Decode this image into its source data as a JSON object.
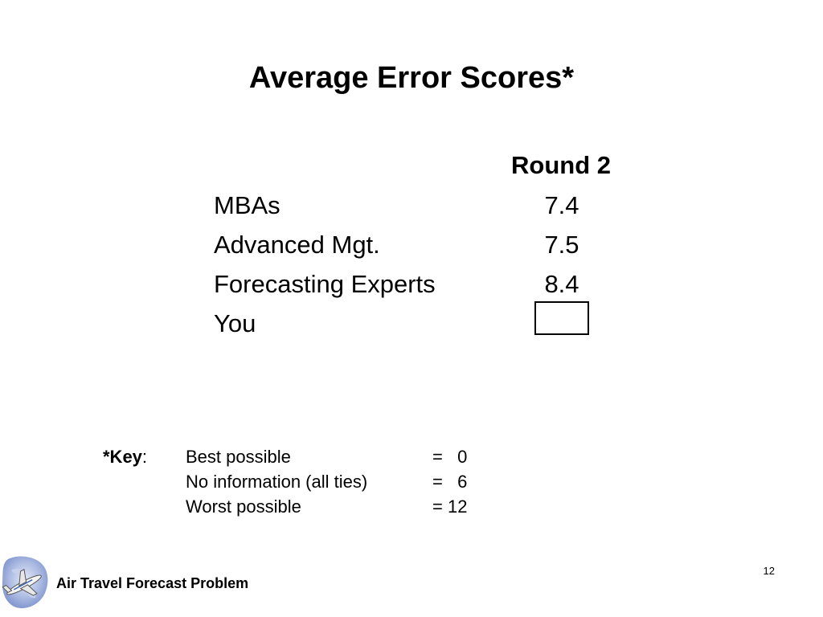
{
  "slide": {
    "title": "Average Error Scores*",
    "column_header": "Round 2",
    "rows": [
      {
        "label": "MBAs",
        "value": "7.4"
      },
      {
        "label": "Advanced Mgt.",
        "value": "7.5"
      },
      {
        "label": "Forecasting Experts",
        "value": "8.4"
      },
      {
        "label": "You",
        "value": ""
      }
    ],
    "key": {
      "label_bold": "*Key",
      "label_suffix": ":",
      "items": [
        {
          "description": "Best possible",
          "equals": "=   0"
        },
        {
          "description": "No information (all ties)",
          "equals": "=   6"
        },
        {
          "description": "Worst possible",
          "equals": "= 12"
        }
      ]
    },
    "footer": {
      "text": "Air Travel Forecast Problem",
      "logo_icon": "airplane-globe-icon"
    },
    "page_number": "12"
  }
}
